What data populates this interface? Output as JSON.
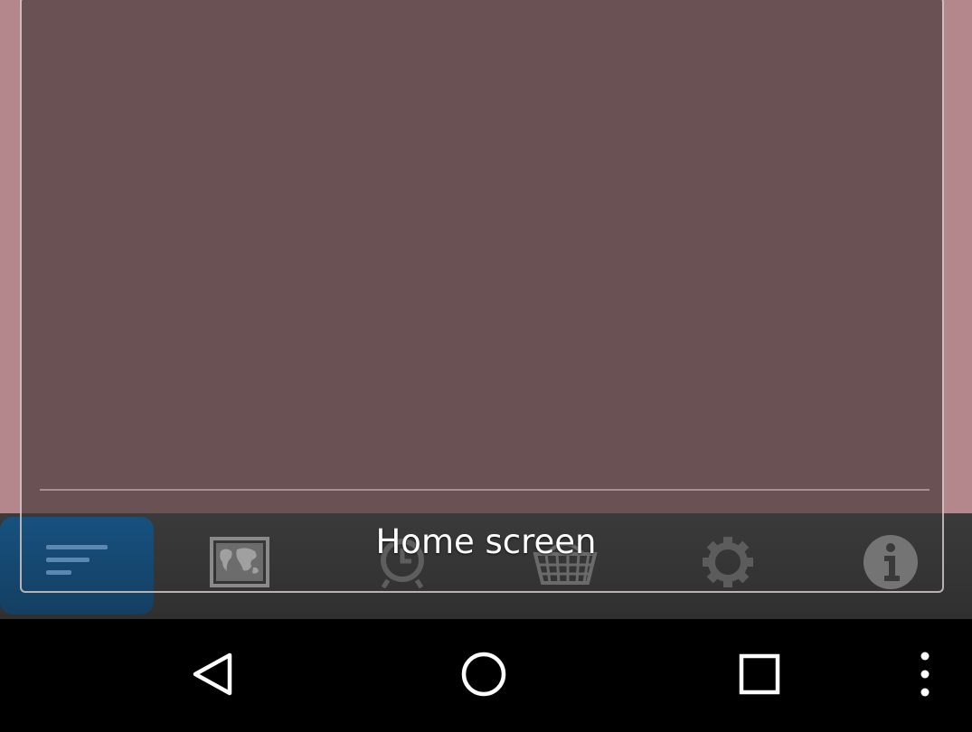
{
  "app_toolbar": {
    "current_screen_label": "Home screen",
    "buttons": [
      {
        "icon": "menu-lines-icon",
        "active": true
      },
      {
        "icon": "world-map-icon",
        "active": false
      },
      {
        "icon": "alarm-clock-icon",
        "active": false
      },
      {
        "icon": "basket-icon",
        "active": false
      },
      {
        "icon": "gear-icon",
        "active": false
      },
      {
        "icon": "info-icon",
        "active": false
      }
    ]
  },
  "nav_bar": {
    "buttons": [
      "back-icon",
      "home-icon",
      "recents-icon",
      "overflow-menu-icon"
    ]
  },
  "colors": {
    "wallpaper": "#b3878b",
    "overlay_panel": "#6a5254",
    "active_button": "#16517f",
    "toolbar": "#353435",
    "icon_gray": "#8a8a8a"
  }
}
